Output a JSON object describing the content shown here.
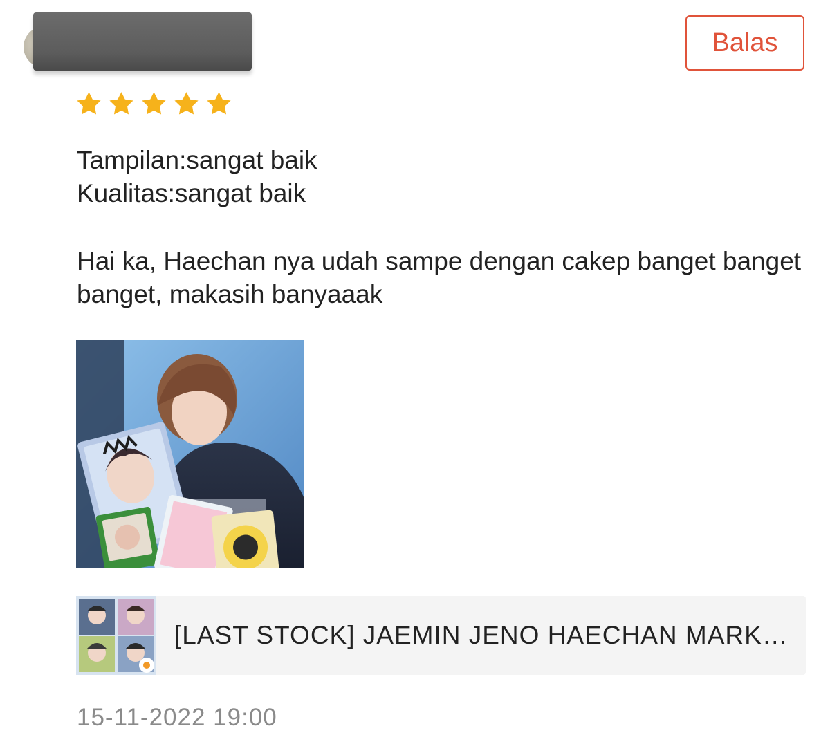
{
  "review": {
    "reviewer": {
      "avatar_icon": "user-avatar"
    },
    "reply_button_label": "Balas",
    "rating": {
      "value": 5,
      "max": 5,
      "color": "#f6b21b"
    },
    "lines": {
      "appearance": "Tampilan:sangat baik",
      "quality": "Kualitas:sangat baik",
      "comment": "Hai ka, Haechan nya udah sampe dengan cakep banget banget banget, makasih banyaaak"
    },
    "photo_icon": "review-photo",
    "product": {
      "title": "[LAST STOCK] JAEMIN JENO HAECHAN MARK BAKER",
      "thumbnail_icon": "product-thumbnail"
    },
    "timestamp": "15-11-2022 19:00"
  },
  "colors": {
    "accent": "#e0533a",
    "star": "#f6b21b",
    "muted_text": "#8a8a8a",
    "card_bg": "#f4f4f4"
  }
}
